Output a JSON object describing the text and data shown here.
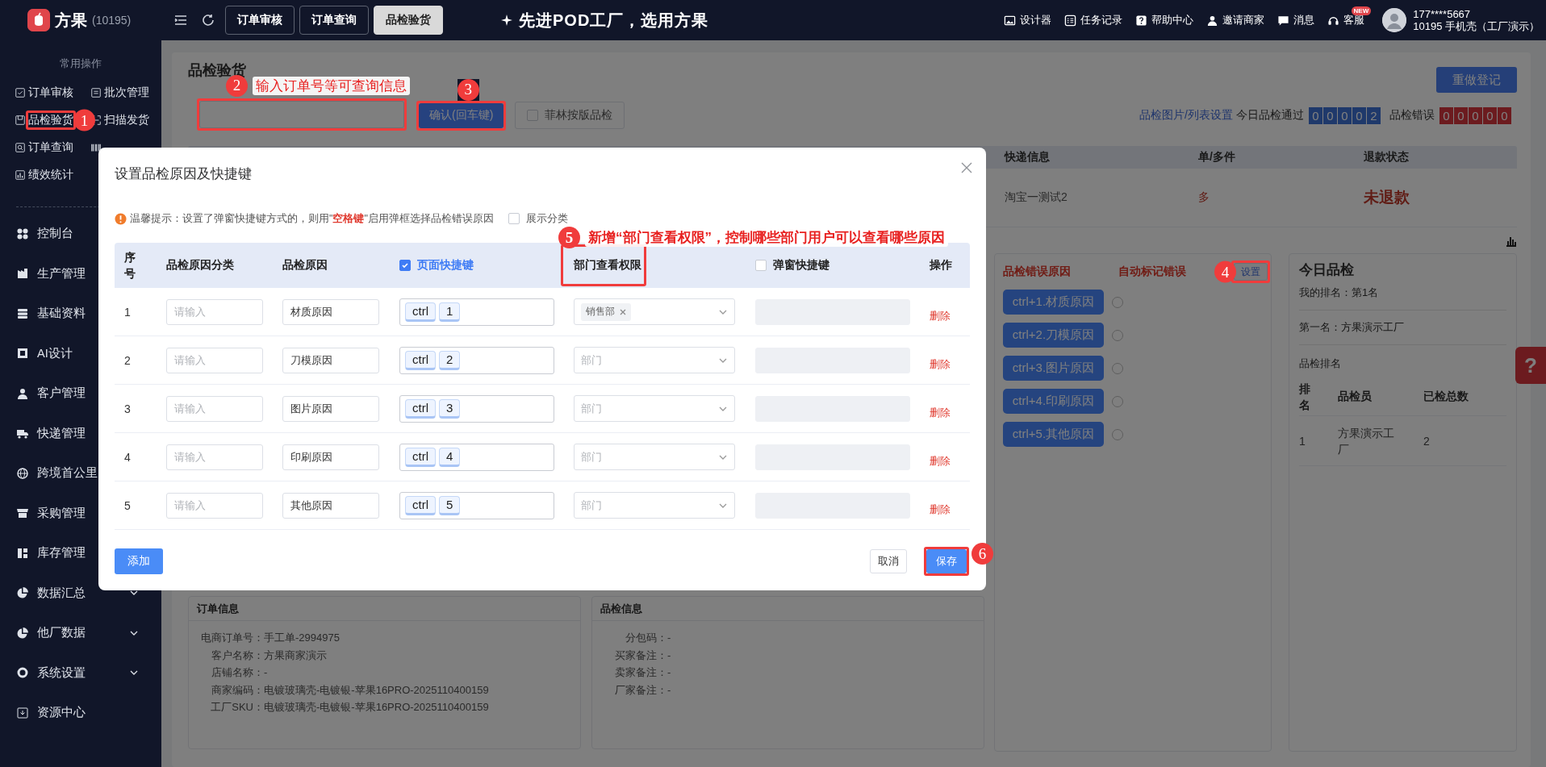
{
  "topbar": {
    "brand": "方果",
    "account": "(10195)",
    "tabs": [
      {
        "label": "订单审核",
        "selected": false
      },
      {
        "label": "订单查询",
        "selected": false
      },
      {
        "label": "品检验货",
        "selected": true
      }
    ],
    "slogan": "先进POD工厂，选用方果",
    "links": [
      {
        "kind": "image",
        "label": "设计器"
      },
      {
        "kind": "list",
        "label": "任务记录"
      },
      {
        "kind": "help",
        "label": "帮助中心"
      },
      {
        "kind": "user",
        "label": "邀请商家"
      },
      {
        "kind": "chat",
        "label": "消息"
      },
      {
        "kind": "headset",
        "label": "客服",
        "badge": "NEW"
      }
    ],
    "user": {
      "phone": "177****5667",
      "company": "10195 手机壳（工厂演示）"
    }
  },
  "sidebar": {
    "section_title": "常用操作",
    "shortcuts": [
      {
        "kind": "check",
        "label": "订单审核"
      },
      {
        "kind": "doc",
        "label": "批次管理"
      },
      {
        "kind": "box",
        "label": "品检验货",
        "callout": "1"
      },
      {
        "kind": "scan",
        "label": "扫描发货"
      },
      {
        "kind": "search",
        "label": "订单查询"
      },
      {
        "kind": "barcode"
      },
      {
        "kind": "chart",
        "label": "绩效统计"
      }
    ],
    "nav": [
      {
        "kind": "dashboard",
        "label": "控制台",
        "expandable": false
      },
      {
        "kind": "factory",
        "label": "生产管理",
        "expandable": false
      },
      {
        "kind": "database",
        "label": "基础资料",
        "expandable": false
      },
      {
        "kind": "ai",
        "label": "AI设计",
        "expandable": false
      },
      {
        "kind": "user",
        "label": "客户管理",
        "expandable": false
      },
      {
        "kind": "truck",
        "label": "快递管理",
        "expandable": false
      },
      {
        "kind": "globe",
        "label": "跨境首公里",
        "expandable": false
      },
      {
        "kind": "store",
        "label": "采购管理",
        "expandable": false
      },
      {
        "kind": "warehouse",
        "label": "库存管理",
        "expandable": false
      },
      {
        "kind": "pie",
        "label": "数据汇总",
        "expandable": true
      },
      {
        "kind": "pie",
        "label": "他厂数据",
        "expandable": true
      },
      {
        "kind": "lifebuoy",
        "label": "系统设置",
        "expandable": true
      },
      {
        "kind": "download",
        "label": "资源中心",
        "expandable": false
      }
    ]
  },
  "main": {
    "title": "品检验货",
    "search": {
      "callout": "2",
      "note": "输入订单号等可查询信息"
    },
    "confirm": {
      "label": "确认(回车键)",
      "callout": "3"
    },
    "film_check": {
      "label": "菲林按版品检",
      "checked": false
    },
    "redo": "重做登记",
    "settings_link": "品检图片/列表设置",
    "pass_label": "今日品检通过",
    "pass_digits": [
      "0",
      "0",
      "0",
      "0",
      "2"
    ],
    "error_label": "品检错误",
    "error_digits": [
      "0",
      "0",
      "0",
      "0",
      "0"
    ],
    "orders": {
      "columns": [
        "快递信息",
        "单/多件",
        "退款状态"
      ],
      "rows": [
        [
          "淘宝一测试2",
          "多",
          "未退款"
        ]
      ]
    },
    "error_panel": {
      "titles": [
        "品检错误原因",
        "自动标记错误"
      ],
      "settings": {
        "label": "设置",
        "callout": "4"
      },
      "reasons": [
        {
          "label": "ctrl+1.材质原因",
          "marked": false
        },
        {
          "label": "ctrl+2.刀模原因",
          "marked": false
        },
        {
          "label": "ctrl+3.图片原因",
          "marked": false
        },
        {
          "label": "ctrl+4.印刷原因",
          "marked": false
        },
        {
          "label": "ctrl+5.其他原因",
          "marked": false
        }
      ]
    },
    "ranking": {
      "title": "今日品检",
      "my_rank": "我的排名：第1名",
      "first": "第一名：方果演示工厂",
      "subtitle": "品检排名",
      "columns": [
        "排名",
        "品检员",
        "已检总数"
      ],
      "rows": [
        [
          "1",
          "方果演示工厂",
          "2"
        ]
      ]
    },
    "order_info": {
      "title": "订单信息",
      "rows": [
        [
          "电商订单号：",
          "手工单-2994975"
        ],
        [
          "客户名称：",
          "方果商家演示"
        ],
        [
          "店铺名称：",
          "-"
        ],
        [
          "商家编码：",
          "电镀玻璃壳-电镀银-苹果16PRO-2025110400159"
        ],
        [
          "工厂SKU：",
          "电镀玻璃壳-电镀银-苹果16PRO-2025110400159"
        ]
      ]
    },
    "check_info": {
      "title": "品检信息",
      "rows": [
        [
          "分包码：",
          "-"
        ],
        [
          "买家备注：",
          "-"
        ],
        [
          "卖家备注：",
          "-"
        ],
        [
          "厂家备注：",
          "-"
        ]
      ]
    },
    "help_tab": "?"
  },
  "modal": {
    "title": "设置品检原因及快捷键",
    "tip": "温馨提示：设置了弹窗快捷键方式的，则用\"**空格键**\"启用弹框选择品检错误原因",
    "show_category": {
      "label": "展示分类",
      "checked": false
    },
    "columns": [
      {
        "label": "序号"
      },
      {
        "label": "品检原因分类"
      },
      {
        "label": "品检原因"
      },
      {
        "label": "页面快捷键",
        "checked": true
      },
      {
        "label": "部门查看权限",
        "callout": "5",
        "note": "新增“部门查看权限”，控制哪些部门用户可以查看哪些原因"
      },
      {
        "label": "弹窗快捷键",
        "checked": false
      },
      {
        "label": "操作"
      }
    ],
    "rows": [
      {
        "index": "1",
        "category_placeholder": "请输入",
        "reason": "材质原因",
        "keys": [
          "ctrl",
          "1"
        ],
        "departments": [
          "销售部"
        ],
        "action": "删除"
      },
      {
        "index": "2",
        "category_placeholder": "请输入",
        "reason": "刀模原因",
        "keys": [
          "ctrl",
          "2"
        ],
        "department_placeholder": "部门",
        "action": "删除"
      },
      {
        "index": "3",
        "category_placeholder": "请输入",
        "reason": "图片原因",
        "keys": [
          "ctrl",
          "3"
        ],
        "department_placeholder": "部门",
        "action": "删除"
      },
      {
        "index": "4",
        "category_placeholder": "请输入",
        "reason": "印刷原因",
        "keys": [
          "ctrl",
          "4"
        ],
        "department_placeholder": "部门",
        "action": "删除"
      },
      {
        "index": "5",
        "category_placeholder": "请输入",
        "reason": "其他原因",
        "keys": [
          "ctrl",
          "5"
        ],
        "department_placeholder": "部门",
        "action": "删除"
      }
    ],
    "add": "添加",
    "cancel": "取消",
    "save": {
      "label": "保存",
      "callout": "6"
    }
  }
}
